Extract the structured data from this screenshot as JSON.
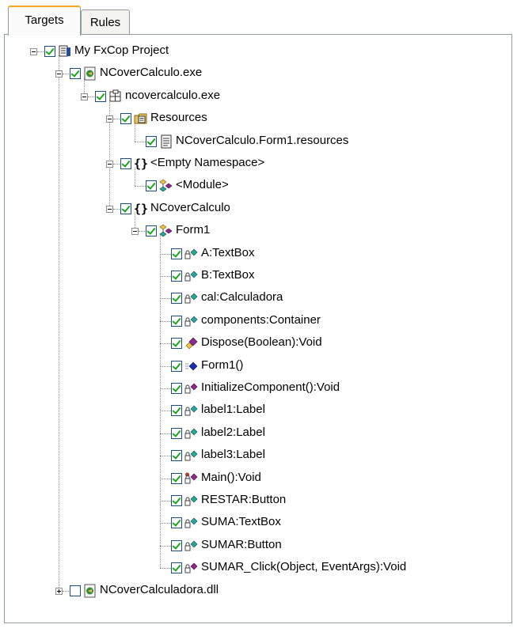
{
  "tabs": [
    {
      "label": "Targets",
      "active": true
    },
    {
      "label": "Rules",
      "active": false
    }
  ],
  "tree": [
    {
      "label": "My FxCop Project",
      "level": 0,
      "expander": "minus",
      "checked": true,
      "icon": "project-icon"
    },
    {
      "label": "NCoverCalculo.exe",
      "level": 1,
      "expander": "minus",
      "checked": true,
      "icon": "executable-file-icon"
    },
    {
      "label": "ncovercalculo.exe",
      "level": 2,
      "expander": "minus",
      "checked": true,
      "icon": "module-icon"
    },
    {
      "label": "Resources",
      "level": 3,
      "expander": "minus",
      "checked": true,
      "icon": "resources-folder-icon"
    },
    {
      "label": "NCoverCalculo.Form1.resources",
      "level": 4,
      "expander": null,
      "checked": true,
      "icon": "resource-file-icon"
    },
    {
      "label": "<Empty Namespace>",
      "level": 3,
      "expander": "minus",
      "checked": true,
      "icon": "namespace-icon"
    },
    {
      "label": "<Module>",
      "level": 4,
      "expander": null,
      "checked": true,
      "icon": "class-icon"
    },
    {
      "label": "NCoverCalculo",
      "level": 3,
      "expander": "minus",
      "checked": true,
      "icon": "namespace-icon"
    },
    {
      "label": "Form1",
      "level": 4,
      "expander": "minus",
      "checked": true,
      "icon": "class-icon"
    },
    {
      "label": "A:TextBox",
      "level": 5,
      "expander": null,
      "checked": true,
      "icon": "private-field-icon"
    },
    {
      "label": "B:TextBox",
      "level": 5,
      "expander": null,
      "checked": true,
      "icon": "private-field-icon"
    },
    {
      "label": "cal:Calculadora",
      "level": 5,
      "expander": null,
      "checked": true,
      "icon": "private-field-icon"
    },
    {
      "label": "components:Container",
      "level": 5,
      "expander": null,
      "checked": true,
      "icon": "private-field-icon"
    },
    {
      "label": "Dispose(Boolean):Void",
      "level": 5,
      "expander": null,
      "checked": true,
      "icon": "protected-method-icon"
    },
    {
      "label": "Form1()",
      "level": 5,
      "expander": null,
      "checked": true,
      "icon": "public-constructor-icon"
    },
    {
      "label": "InitializeComponent():Void",
      "level": 5,
      "expander": null,
      "checked": true,
      "icon": "private-method-icon"
    },
    {
      "label": "label1:Label",
      "level": 5,
      "expander": null,
      "checked": true,
      "icon": "private-field-icon"
    },
    {
      "label": "label2:Label",
      "level": 5,
      "expander": null,
      "checked": true,
      "icon": "private-field-icon"
    },
    {
      "label": "label3:Label",
      "level": 5,
      "expander": null,
      "checked": true,
      "icon": "private-field-icon"
    },
    {
      "label": "Main():Void",
      "level": 5,
      "expander": null,
      "checked": true,
      "icon": "private-static-method-icon"
    },
    {
      "label": "RESTAR:Button",
      "level": 5,
      "expander": null,
      "checked": true,
      "icon": "private-field-icon"
    },
    {
      "label": "SUMA:TextBox",
      "level": 5,
      "expander": null,
      "checked": true,
      "icon": "private-field-icon"
    },
    {
      "label": "SUMAR:Button",
      "level": 5,
      "expander": null,
      "checked": true,
      "icon": "private-field-icon"
    },
    {
      "label": "SUMAR_Click(Object, EventArgs):Void",
      "level": 5,
      "expander": null,
      "checked": true,
      "icon": "private-method-icon"
    },
    {
      "label": "NCoverCalculadora.dll",
      "level": 1,
      "expander": "plus",
      "checked": false,
      "icon": "library-file-icon"
    }
  ],
  "colors": {
    "checkmark": "#21a121",
    "tab_accent": "#f5a623",
    "field": "#2aa59a",
    "method": "#8b2a8b",
    "constructor": "#1a2ea8"
  }
}
